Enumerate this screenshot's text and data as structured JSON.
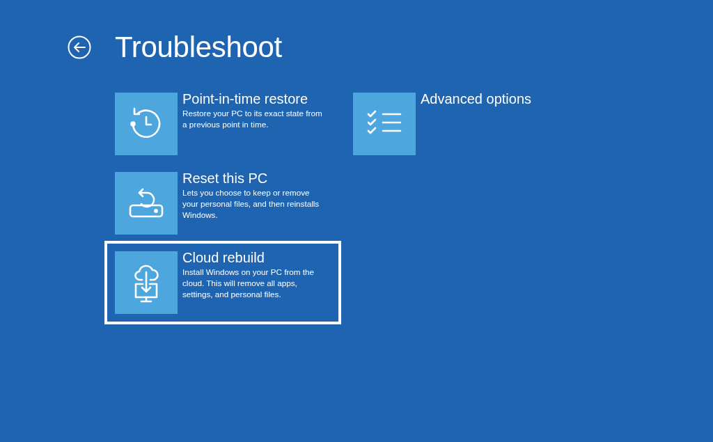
{
  "header": {
    "title": "Troubleshoot"
  },
  "columns": [
    {
      "options": [
        {
          "kind": "restore",
          "title": "Point-in-time restore",
          "description": "Restore your PC to its exact state from a previous point in time.",
          "selected": false
        },
        {
          "kind": "reset",
          "title": "Reset this PC",
          "description": "Lets you choose to keep or remove your personal files, and then reinstalls Windows.",
          "selected": false
        },
        {
          "kind": "cloud",
          "title": "Cloud rebuild",
          "description": "Install Windows on your PC from the cloud. This will remove all apps, settings, and personal files.",
          "selected": true
        }
      ]
    },
    {
      "options": [
        {
          "kind": "advanced",
          "title": "Advanced options",
          "selected": false
        }
      ]
    }
  ]
}
